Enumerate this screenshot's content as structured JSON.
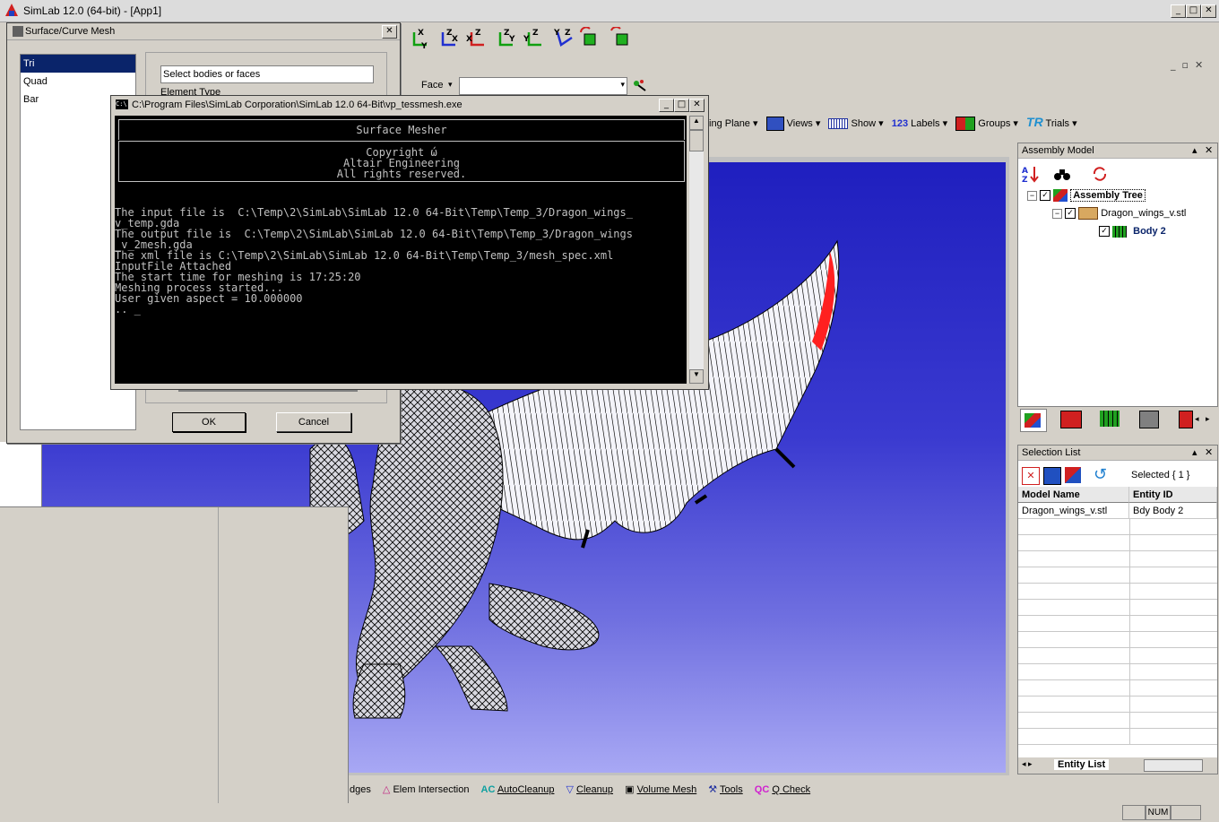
{
  "app": {
    "title": "SimLab 12.0 (64-bit) - [App1]",
    "min_glyph": "_",
    "max_glyph": "□",
    "close_glyph": "✕"
  },
  "toolbar": {
    "face_label": "Face",
    "view_icons": [
      "ẋY",
      "ẑX",
      "ẋZ",
      "ẑY",
      "ẏZ",
      "ẏZ"
    ],
    "menus": {
      "cutting_plane": "ting Plane",
      "views": "Views",
      "show": "Show",
      "labels": "Labels",
      "labels_icon": "123",
      "groups": "Groups",
      "trials": "Trials",
      "trials_icon": "TR"
    },
    "arrow": "▾"
  },
  "assembly_model": {
    "title": "Assembly Model",
    "pin": "▴",
    "close": "✕",
    "sort_icon": "A Z",
    "tree": {
      "root": "Assembly Tree",
      "child": "Dragon_wings_v.stl",
      "leaf": "Body 2"
    }
  },
  "selection_list": {
    "title": "Selection List",
    "selected": "Selected { 1 }",
    "columns": [
      "Model Name",
      "Entity ID"
    ],
    "rows": [
      [
        "Dragon_wings_v.stl",
        "Bdy Body 2"
      ]
    ],
    "tab": "Entity List"
  },
  "dialog": {
    "title": "Surface/Curve Mesh",
    "close": "✕",
    "types": [
      "Tri",
      "Quad",
      "Bar"
    ],
    "select_placeholder": "Select bodies or faces",
    "element_type_label": "Element Type",
    "ok": "OK",
    "cancel": "Cancel"
  },
  "console": {
    "title": "C:\\Program Files\\SimLab Corporation\\SimLab 12.0 64-Bit\\vp_tessmesh.exe",
    "icon": "C:\\",
    "header": {
      "name": "Surface Mesher",
      "copyright": "Copyright ώ",
      "company": "Altair Engineering",
      "rights": "All rights reserved."
    },
    "lines": [
      "The input file is  C:\\Temp\\2\\SimLab\\SimLab 12.0 64-Bit\\Temp\\Temp_3/Dragon_wings_",
      "v_temp.gda",
      "The output file is  C:\\Temp\\2\\SimLab\\SimLab 12.0 64-Bit\\Temp\\Temp_3/Dragon_wings",
      "_v_2mesh.gda",
      "The xml file is C:\\Temp\\2\\SimLab\\SimLab 12.0 64-Bit\\Temp\\Temp_3/mesh_spec.xml",
      "InputFile Attached",
      "The start time for meshing is 17:25:20",
      "Meshing process started...",
      "User given aspect = 10.000000",
      ".. _"
    ]
  },
  "bottom_toolbar": {
    "edges": "dges",
    "elem_intersection": "Elem Intersection",
    "autocleanup": "AutoCleanup",
    "autocleanup_icon": "AC",
    "cleanup": "Cleanup",
    "volume_mesh": "Volume Mesh",
    "tools": "Tools",
    "qcheck": "Q Check",
    "qcheck_icon": "QC"
  },
  "status": {
    "num": "NUM"
  },
  "colors": {
    "selection_highlight": "#0a246a",
    "viewport_top": "#1f1fbf",
    "viewport_bottom": "#a8a8f4",
    "wing_highlight": "#ff2020"
  }
}
